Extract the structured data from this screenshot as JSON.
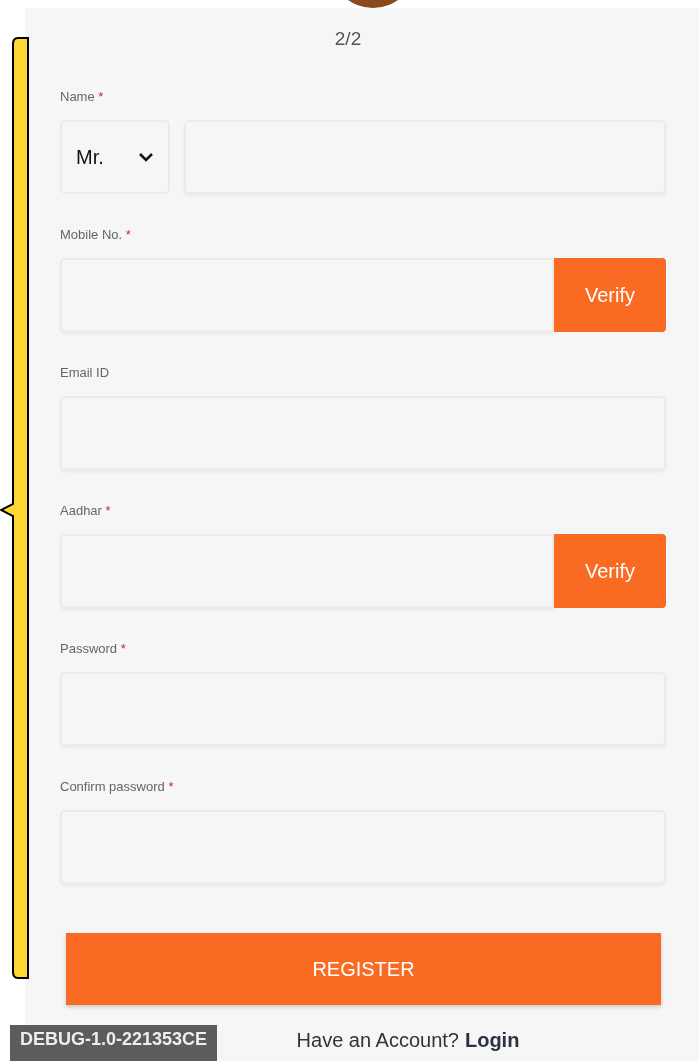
{
  "step": "2/2",
  "fields": [
    {
      "kind": "select_text",
      "label": "Name",
      "required_mark": "*",
      "select_value": "Mr."
    },
    {
      "kind": "verify",
      "label": "Mobile No.",
      "required_mark": "*",
      "button": "Verify"
    },
    {
      "kind": "text",
      "label": "Email ID"
    },
    {
      "kind": "verify",
      "label": "Aadhar",
      "required_mark": "*",
      "button": "Verify"
    },
    {
      "kind": "text",
      "label": "Password",
      "required_mark": "*"
    },
    {
      "kind": "text",
      "label": "Confirm password",
      "required_mark": "*"
    }
  ],
  "submit": "REGISTER",
  "footer": {
    "text": "Have an Account?",
    "link": "Login"
  },
  "debug_banner": "DEBUG-1.0-221353CE"
}
